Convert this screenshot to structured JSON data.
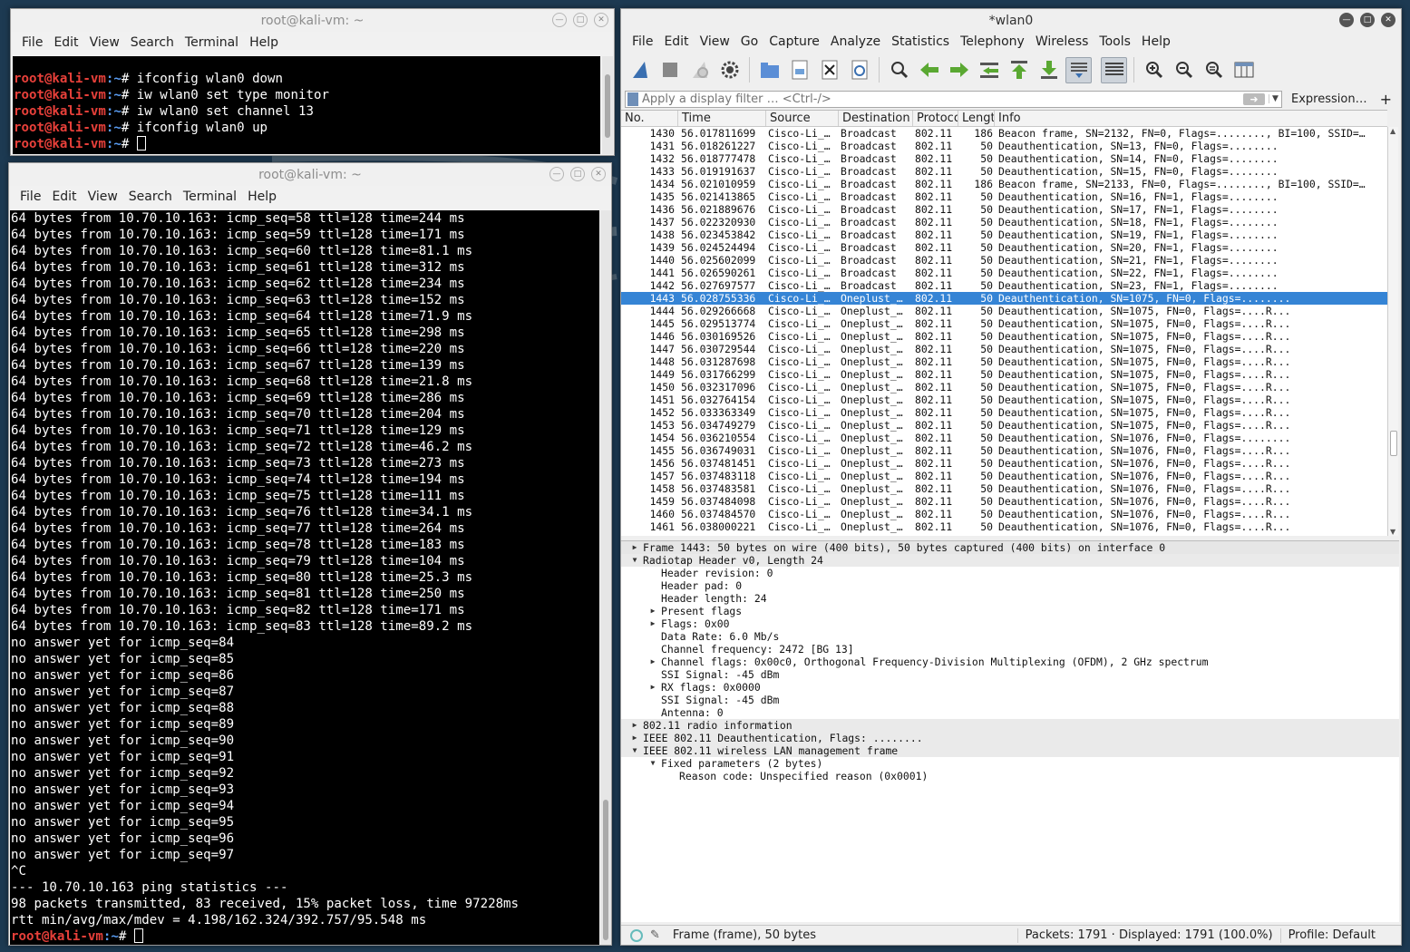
{
  "terminal1": {
    "title": "root@kali-vm: ~",
    "menu": [
      "File",
      "Edit",
      "View",
      "Search",
      "Terminal",
      "Help"
    ],
    "prompt_user": "root@kali-vm",
    "prompt_path": ":~",
    "prompt_sym": "# ",
    "commands": [
      "ifconfig wlan0 down",
      "iw wlan0 set type monitor",
      "iw wlan0 set channel 13",
      "ifconfig wlan0 up"
    ]
  },
  "terminal2": {
    "title": "root@kali-vm: ~",
    "menu": [
      "File",
      "Edit",
      "View",
      "Search",
      "Terminal",
      "Help"
    ],
    "lines": [
      "64 bytes from 10.70.10.163: icmp_seq=58 ttl=128 time=244 ms",
      "64 bytes from 10.70.10.163: icmp_seq=59 ttl=128 time=171 ms",
      "64 bytes from 10.70.10.163: icmp_seq=60 ttl=128 time=81.1 ms",
      "64 bytes from 10.70.10.163: icmp_seq=61 ttl=128 time=312 ms",
      "64 bytes from 10.70.10.163: icmp_seq=62 ttl=128 time=234 ms",
      "64 bytes from 10.70.10.163: icmp_seq=63 ttl=128 time=152 ms",
      "64 bytes from 10.70.10.163: icmp_seq=64 ttl=128 time=71.9 ms",
      "64 bytes from 10.70.10.163: icmp_seq=65 ttl=128 time=298 ms",
      "64 bytes from 10.70.10.163: icmp_seq=66 ttl=128 time=220 ms",
      "64 bytes from 10.70.10.163: icmp_seq=67 ttl=128 time=139 ms",
      "64 bytes from 10.70.10.163: icmp_seq=68 ttl=128 time=21.8 ms",
      "64 bytes from 10.70.10.163: icmp_seq=69 ttl=128 time=286 ms",
      "64 bytes from 10.70.10.163: icmp_seq=70 ttl=128 time=204 ms",
      "64 bytes from 10.70.10.163: icmp_seq=71 ttl=128 time=129 ms",
      "64 bytes from 10.70.10.163: icmp_seq=72 ttl=128 time=46.2 ms",
      "64 bytes from 10.70.10.163: icmp_seq=73 ttl=128 time=273 ms",
      "64 bytes from 10.70.10.163: icmp_seq=74 ttl=128 time=194 ms",
      "64 bytes from 10.70.10.163: icmp_seq=75 ttl=128 time=111 ms",
      "64 bytes from 10.70.10.163: icmp_seq=76 ttl=128 time=34.1 ms",
      "64 bytes from 10.70.10.163: icmp_seq=77 ttl=128 time=264 ms",
      "64 bytes from 10.70.10.163: icmp_seq=78 ttl=128 time=183 ms",
      "64 bytes from 10.70.10.163: icmp_seq=79 ttl=128 time=104 ms",
      "64 bytes from 10.70.10.163: icmp_seq=80 ttl=128 time=25.3 ms",
      "64 bytes from 10.70.10.163: icmp_seq=81 ttl=128 time=250 ms",
      "64 bytes from 10.70.10.163: icmp_seq=82 ttl=128 time=171 ms",
      "64 bytes from 10.70.10.163: icmp_seq=83 ttl=128 time=89.2 ms",
      "no answer yet for icmp_seq=84",
      "no answer yet for icmp_seq=85",
      "no answer yet for icmp_seq=86",
      "no answer yet for icmp_seq=87",
      "no answer yet for icmp_seq=88",
      "no answer yet for icmp_seq=89",
      "no answer yet for icmp_seq=90",
      "no answer yet for icmp_seq=91",
      "no answer yet for icmp_seq=92",
      "no answer yet for icmp_seq=93",
      "no answer yet for icmp_seq=94",
      "no answer yet for icmp_seq=95",
      "no answer yet for icmp_seq=96",
      "no answer yet for icmp_seq=97",
      "^C",
      "--- 10.70.10.163 ping statistics ---",
      "98 packets transmitted, 83 received, 15% packet loss, time 97228ms",
      "rtt min/avg/max/mdev = 4.198/162.324/392.757/95.548 ms"
    ],
    "prompt_user": "root@kali-vm",
    "prompt_path": ":~",
    "prompt_sym": "# "
  },
  "wireshark": {
    "title": "*wlan0",
    "menu": [
      "File",
      "Edit",
      "View",
      "Go",
      "Capture",
      "Analyze",
      "Statistics",
      "Telephony",
      "Wireless",
      "Tools",
      "Help"
    ],
    "filter_placeholder": "Apply a display filter … <Ctrl-/>",
    "expression_label": "Expression…",
    "add_label": "+",
    "columns": [
      "No.",
      "Time",
      "Source",
      "Destination",
      "Protocol",
      "Length",
      "Info"
    ],
    "selected_no": "1443",
    "packets": [
      [
        "1430",
        "56.017811699",
        "Cisco-Li_…",
        "Broadcast",
        "802.11",
        "186",
        "Beacon frame, SN=2132, FN=0, Flags=........, BI=100, SSID=…"
      ],
      [
        "1431",
        "56.018261227",
        "Cisco-Li_…",
        "Broadcast",
        "802.11",
        "50",
        "Deauthentication, SN=13, FN=0, Flags=........"
      ],
      [
        "1432",
        "56.018777478",
        "Cisco-Li_…",
        "Broadcast",
        "802.11",
        "50",
        "Deauthentication, SN=14, FN=0, Flags=........"
      ],
      [
        "1433",
        "56.019191637",
        "Cisco-Li_…",
        "Broadcast",
        "802.11",
        "50",
        "Deauthentication, SN=15, FN=0, Flags=........"
      ],
      [
        "1434",
        "56.021010959",
        "Cisco-Li_…",
        "Broadcast",
        "802.11",
        "186",
        "Beacon frame, SN=2133, FN=0, Flags=........, BI=100, SSID=…"
      ],
      [
        "1435",
        "56.021413865",
        "Cisco-Li_…",
        "Broadcast",
        "802.11",
        "50",
        "Deauthentication, SN=16, FN=1, Flags=........"
      ],
      [
        "1436",
        "56.021889676",
        "Cisco-Li_…",
        "Broadcast",
        "802.11",
        "50",
        "Deauthentication, SN=17, FN=1, Flags=........"
      ],
      [
        "1437",
        "56.022320930",
        "Cisco-Li_…",
        "Broadcast",
        "802.11",
        "50",
        "Deauthentication, SN=18, FN=1, Flags=........"
      ],
      [
        "1438",
        "56.023453842",
        "Cisco-Li_…",
        "Broadcast",
        "802.11",
        "50",
        "Deauthentication, SN=19, FN=1, Flags=........"
      ],
      [
        "1439",
        "56.024524494",
        "Cisco-Li_…",
        "Broadcast",
        "802.11",
        "50",
        "Deauthentication, SN=20, FN=1, Flags=........"
      ],
      [
        "1440",
        "56.025602099",
        "Cisco-Li_…",
        "Broadcast",
        "802.11",
        "50",
        "Deauthentication, SN=21, FN=1, Flags=........"
      ],
      [
        "1441",
        "56.026590261",
        "Cisco-Li_…",
        "Broadcast",
        "802.11",
        "50",
        "Deauthentication, SN=22, FN=1, Flags=........"
      ],
      [
        "1442",
        "56.027697577",
        "Cisco-Li_…",
        "Broadcast",
        "802.11",
        "50",
        "Deauthentication, SN=23, FN=1, Flags=........"
      ],
      [
        "1443",
        "56.028755336",
        "Cisco-Li_…",
        "Oneplust_…",
        "802.11",
        "50",
        "Deauthentication, SN=1075, FN=0, Flags=........"
      ],
      [
        "1444",
        "56.029266668",
        "Cisco-Li_…",
        "Oneplust_…",
        "802.11",
        "50",
        "Deauthentication, SN=1075, FN=0, Flags=....R..."
      ],
      [
        "1445",
        "56.029513774",
        "Cisco-Li_…",
        "Oneplust_…",
        "802.11",
        "50",
        "Deauthentication, SN=1075, FN=0, Flags=....R..."
      ],
      [
        "1446",
        "56.030169526",
        "Cisco-Li_…",
        "Oneplust_…",
        "802.11",
        "50",
        "Deauthentication, SN=1075, FN=0, Flags=....R..."
      ],
      [
        "1447",
        "56.030729544",
        "Cisco-Li_…",
        "Oneplust_…",
        "802.11",
        "50",
        "Deauthentication, SN=1075, FN=0, Flags=....R..."
      ],
      [
        "1448",
        "56.031287698",
        "Cisco-Li_…",
        "Oneplust_…",
        "802.11",
        "50",
        "Deauthentication, SN=1075, FN=0, Flags=....R..."
      ],
      [
        "1449",
        "56.031766299",
        "Cisco-Li_…",
        "Oneplust_…",
        "802.11",
        "50",
        "Deauthentication, SN=1075, FN=0, Flags=....R..."
      ],
      [
        "1450",
        "56.032317096",
        "Cisco-Li_…",
        "Oneplust_…",
        "802.11",
        "50",
        "Deauthentication, SN=1075, FN=0, Flags=....R..."
      ],
      [
        "1451",
        "56.032764154",
        "Cisco-Li_…",
        "Oneplust_…",
        "802.11",
        "50",
        "Deauthentication, SN=1075, FN=0, Flags=....R..."
      ],
      [
        "1452",
        "56.033363349",
        "Cisco-Li_…",
        "Oneplust_…",
        "802.11",
        "50",
        "Deauthentication, SN=1075, FN=0, Flags=....R..."
      ],
      [
        "1453",
        "56.034749279",
        "Cisco-Li_…",
        "Oneplust_…",
        "802.11",
        "50",
        "Deauthentication, SN=1075, FN=0, Flags=....R..."
      ],
      [
        "1454",
        "56.036210554",
        "Cisco-Li_…",
        "Oneplust_…",
        "802.11",
        "50",
        "Deauthentication, SN=1076, FN=0, Flags=........"
      ],
      [
        "1455",
        "56.036749031",
        "Cisco-Li_…",
        "Oneplust_…",
        "802.11",
        "50",
        "Deauthentication, SN=1076, FN=0, Flags=....R..."
      ],
      [
        "1456",
        "56.037481451",
        "Cisco-Li_…",
        "Oneplust_…",
        "802.11",
        "50",
        "Deauthentication, SN=1076, FN=0, Flags=....R..."
      ],
      [
        "1457",
        "56.037483118",
        "Cisco-Li_…",
        "Oneplust_…",
        "802.11",
        "50",
        "Deauthentication, SN=1076, FN=0, Flags=....R..."
      ],
      [
        "1458",
        "56.037483581",
        "Cisco-Li_…",
        "Oneplust_…",
        "802.11",
        "50",
        "Deauthentication, SN=1076, FN=0, Flags=....R..."
      ],
      [
        "1459",
        "56.037484098",
        "Cisco-Li_…",
        "Oneplust_…",
        "802.11",
        "50",
        "Deauthentication, SN=1076, FN=0, Flags=....R..."
      ],
      [
        "1460",
        "56.037484570",
        "Cisco-Li_…",
        "Oneplust_…",
        "802.11",
        "50",
        "Deauthentication, SN=1076, FN=0, Flags=....R..."
      ],
      [
        "1461",
        "56.038000221",
        "Cisco-Li_…",
        "Oneplust_…",
        "802.11",
        "50",
        "Deauthentication, SN=1076, FN=0, Flags=....R..."
      ]
    ],
    "details": [
      {
        "level": 0,
        "exp": "collapsed",
        "text": "Frame 1443: 50 bytes on wire (400 bits), 50 bytes captured (400 bits) on interface 0"
      },
      {
        "level": 0,
        "exp": "expanded",
        "text": "Radiotap Header v0, Length 24"
      },
      {
        "level": 1,
        "exp": "none",
        "text": "Header revision: 0"
      },
      {
        "level": 1,
        "exp": "none",
        "text": "Header pad: 0"
      },
      {
        "level": 1,
        "exp": "none",
        "text": "Header length: 24"
      },
      {
        "level": 1,
        "exp": "collapsed",
        "text": "Present flags"
      },
      {
        "level": 1,
        "exp": "collapsed",
        "text": "Flags: 0x00"
      },
      {
        "level": 1,
        "exp": "none",
        "text": "Data Rate: 6.0 Mb/s"
      },
      {
        "level": 1,
        "exp": "none",
        "text": "Channel frequency: 2472 [BG 13]"
      },
      {
        "level": 1,
        "exp": "collapsed",
        "text": "Channel flags: 0x00c0, Orthogonal Frequency-Division Multiplexing (OFDM), 2 GHz spectrum"
      },
      {
        "level": 1,
        "exp": "none",
        "text": "SSI Signal: -45 dBm"
      },
      {
        "level": 1,
        "exp": "collapsed",
        "text": "RX flags: 0x0000"
      },
      {
        "level": 1,
        "exp": "none",
        "text": "SSI Signal: -45 dBm"
      },
      {
        "level": 1,
        "exp": "none",
        "text": "Antenna: 0"
      },
      {
        "level": 0,
        "exp": "collapsed",
        "text": "802.11 radio information"
      },
      {
        "level": 0,
        "exp": "collapsed",
        "text": "IEEE 802.11 Deauthentication, Flags: ........"
      },
      {
        "level": 0,
        "exp": "expanded",
        "text": "IEEE 802.11 wireless LAN management frame"
      },
      {
        "level": 1,
        "exp": "expanded",
        "text": "Fixed parameters (2 bytes)"
      },
      {
        "level": 2,
        "exp": "none",
        "text": "Reason code: Unspecified reason (0x0001)"
      }
    ],
    "status": {
      "frame": "Frame (frame), 50 bytes",
      "packets": "Packets: 1791 · Displayed: 1791 (100.0%)",
      "profile": "Profile: Default"
    }
  },
  "colors": {
    "desktop": "#1d3a52",
    "prompt_user": "#e8403a",
    "prompt_path": "#5a9cf2",
    "selection": "#3584d5"
  }
}
